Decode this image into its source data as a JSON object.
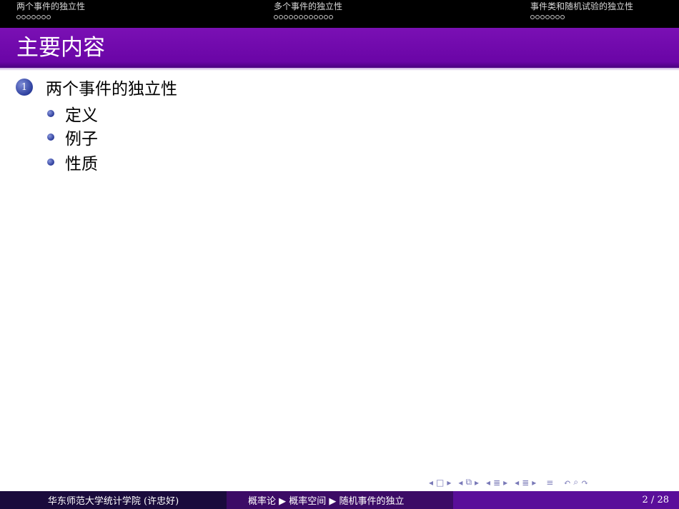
{
  "header": {
    "sections": [
      {
        "title": "两个事件的独立性",
        "dots": 7
      },
      {
        "title": "多个事件的独立性",
        "dots": 12
      },
      {
        "title": "事件类和随机试验的独立性",
        "dots": 7
      }
    ]
  },
  "frame": {
    "title": "主要内容",
    "section_number": "1",
    "section_title": "两个事件的独立性",
    "items": [
      "定义",
      "例子",
      "性质"
    ]
  },
  "navigation_icons": [
    "prev-frame-icon",
    "frame-icon",
    "next-frame-icon",
    "prev-subsection-icon",
    "subsection-icon",
    "next-subsection-icon",
    "prev-section-icon",
    "section-icon",
    "next-section-icon",
    "prev-appendix-icon",
    "appendix-icon",
    "next-appendix-icon",
    "align-icon",
    "search-back-icon",
    "search-icon",
    "search-forward-icon"
  ],
  "footer": {
    "institution": "华东师范大学统计学院  (许忠好)",
    "breadcrumb": "概率论 ▶ 概率空间 ▶ 随机事件的独立",
    "page": "2 / 28"
  },
  "colors": {
    "titlebar": "#6a05a6",
    "footer_left": "#1a0b3c",
    "footer_mid": "#3c0b66",
    "footer_right": "#5a0e9a"
  }
}
